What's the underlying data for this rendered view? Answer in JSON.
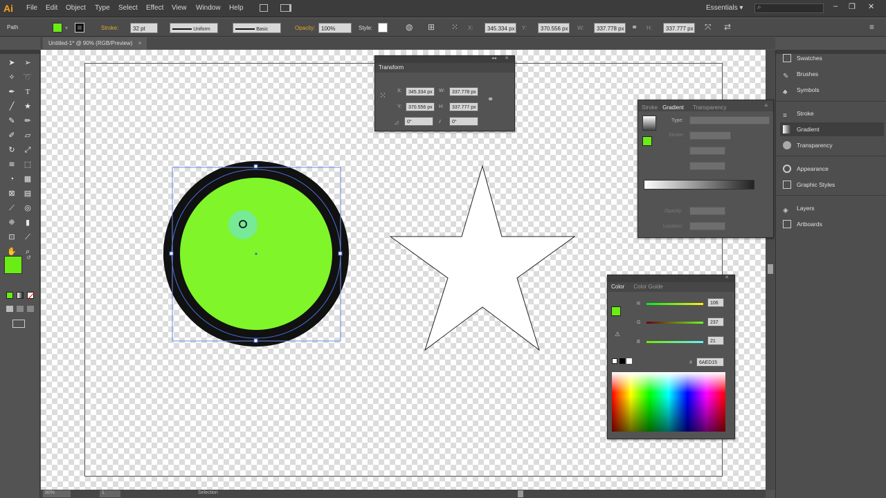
{
  "app": {
    "logo": "Ai"
  },
  "menu": [
    "File",
    "Edit",
    "Object",
    "Type",
    "Select",
    "Effect",
    "View",
    "Window",
    "Help"
  ],
  "workspace": {
    "label": "Essentials",
    "arrow": "▾"
  },
  "window_controls": {
    "minimize": "–",
    "restore": "❐",
    "close": "✕"
  },
  "control_bar": {
    "object_type": "Path",
    "stroke_label": "Stroke:",
    "stroke_weight": "32 pt",
    "profile": "Uniform",
    "brush": "Basic",
    "opacity_label": "Opacity:",
    "opacity": "100%",
    "style_label": "Style:",
    "x_label": "X:",
    "x": "345.334 px",
    "y_label": "Y:",
    "y": "370.556 px",
    "w_label": "W:",
    "w": "337.778 px",
    "h_label": "H:",
    "h": "337.777 px"
  },
  "document": {
    "tab_label": "Untitled-1* @ 90% (RGB/Preview)",
    "close": "×"
  },
  "transform_panel": {
    "title": "Transform",
    "x_label": "X:",
    "x": "345.334 px",
    "y_label": "Y:",
    "y": "370.556 px",
    "w_label": "W:",
    "w": "337.778 px",
    "h_label": "H:",
    "h": "337.777 px",
    "rotate": "0°",
    "shear": "0°"
  },
  "gradient_panel": {
    "tabs": [
      "Stroke",
      "Gradient",
      "Transparency"
    ],
    "type_label": "Type:",
    "stroke_label": "Stroke:",
    "opacity_label": "Opacity:",
    "location_label": "Location:"
  },
  "color_panel": {
    "tabs": [
      "Color",
      "Color Guide"
    ],
    "r_label": "R",
    "r": "106",
    "g_label": "G",
    "g": "237",
    "b_label": "B",
    "b": "21",
    "hex_label": "#",
    "hex": "6AED15"
  },
  "right_dock": [
    {
      "label": "Swatches",
      "icon": "swatches-icon"
    },
    {
      "label": "Brushes",
      "icon": "brushes-icon"
    },
    {
      "label": "Symbols",
      "icon": "symbols-icon"
    },
    {
      "label": "Stroke",
      "icon": "stroke-icon"
    },
    {
      "label": "Gradient",
      "icon": "gradient-icon"
    },
    {
      "label": "Transparency",
      "icon": "transparency-icon"
    },
    {
      "label": "Appearance",
      "icon": "appearance-icon"
    },
    {
      "label": "Graphic Styles",
      "icon": "graphic-styles-icon"
    },
    {
      "label": "Layers",
      "icon": "layers-icon"
    },
    {
      "label": "Artboards",
      "icon": "artboards-icon"
    }
  ],
  "status_bar": {
    "zoom": "90%",
    "page": "1",
    "tool": "Selection"
  },
  "colors": {
    "fill": "#6AED15",
    "stroke": "#111111",
    "accent": "#7ff52a"
  }
}
